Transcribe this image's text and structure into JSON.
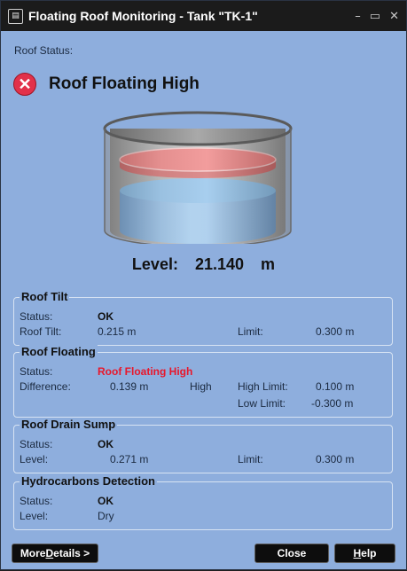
{
  "window": {
    "title": "Floating Roof Monitoring - Tank \"TK-1\"",
    "icon": "document-icon",
    "controls": [
      "minimize-icon",
      "maximize-icon",
      "close-icon"
    ]
  },
  "status": {
    "label": "Roof Status:",
    "value": "Roof Floating High",
    "icon": "error-x-icon",
    "color": "#e2314a"
  },
  "tank_graphic": {
    "liquid_color": "#3b8fe0",
    "roof_color": "#f22b2b"
  },
  "level": {
    "label": "Level:",
    "value": "21.140",
    "unit": "m"
  },
  "groups": {
    "roof_tilt": {
      "title": "Roof Tilt",
      "status_label": "Status:",
      "status_value": "OK",
      "tilt_label": "Roof Tilt:",
      "tilt_value": "0.215 m",
      "limit_label": "Limit:",
      "limit_value": "0.300 m"
    },
    "roof_floating": {
      "title": "Roof Floating",
      "status_label": "Status:",
      "status_value": "Roof Floating High",
      "status_color": "#e8172b",
      "difference_label": "Difference:",
      "difference_value": "0.139 m",
      "difference_state": "High",
      "high_limit_label": "High Limit:",
      "high_limit_value": "0.100 m",
      "low_limit_label": "Low Limit:",
      "low_limit_value": "-0.300 m"
    },
    "roof_drain_sump": {
      "title": "Roof Drain Sump",
      "status_label": "Status:",
      "status_value": "OK",
      "level_label": "Level:",
      "level_value": "0.271 m",
      "limit_label": "Limit:",
      "limit_value": "0.300 m"
    },
    "hydrocarbons": {
      "title": "Hydrocarbons Detection",
      "status_label": "Status:",
      "status_value": "OK",
      "level_label": "Level:",
      "level_value": "Dry"
    }
  },
  "buttons": {
    "more_details_prefix": "More ",
    "more_details_key": "D",
    "more_details_suffix": "etails >",
    "close": "Close",
    "help_key": "H",
    "help_suffix": "elp"
  },
  "colors": {
    "background": "#8eaedd",
    "titlebar": "#1b1b1b",
    "alarm_red": "#e8172b"
  }
}
